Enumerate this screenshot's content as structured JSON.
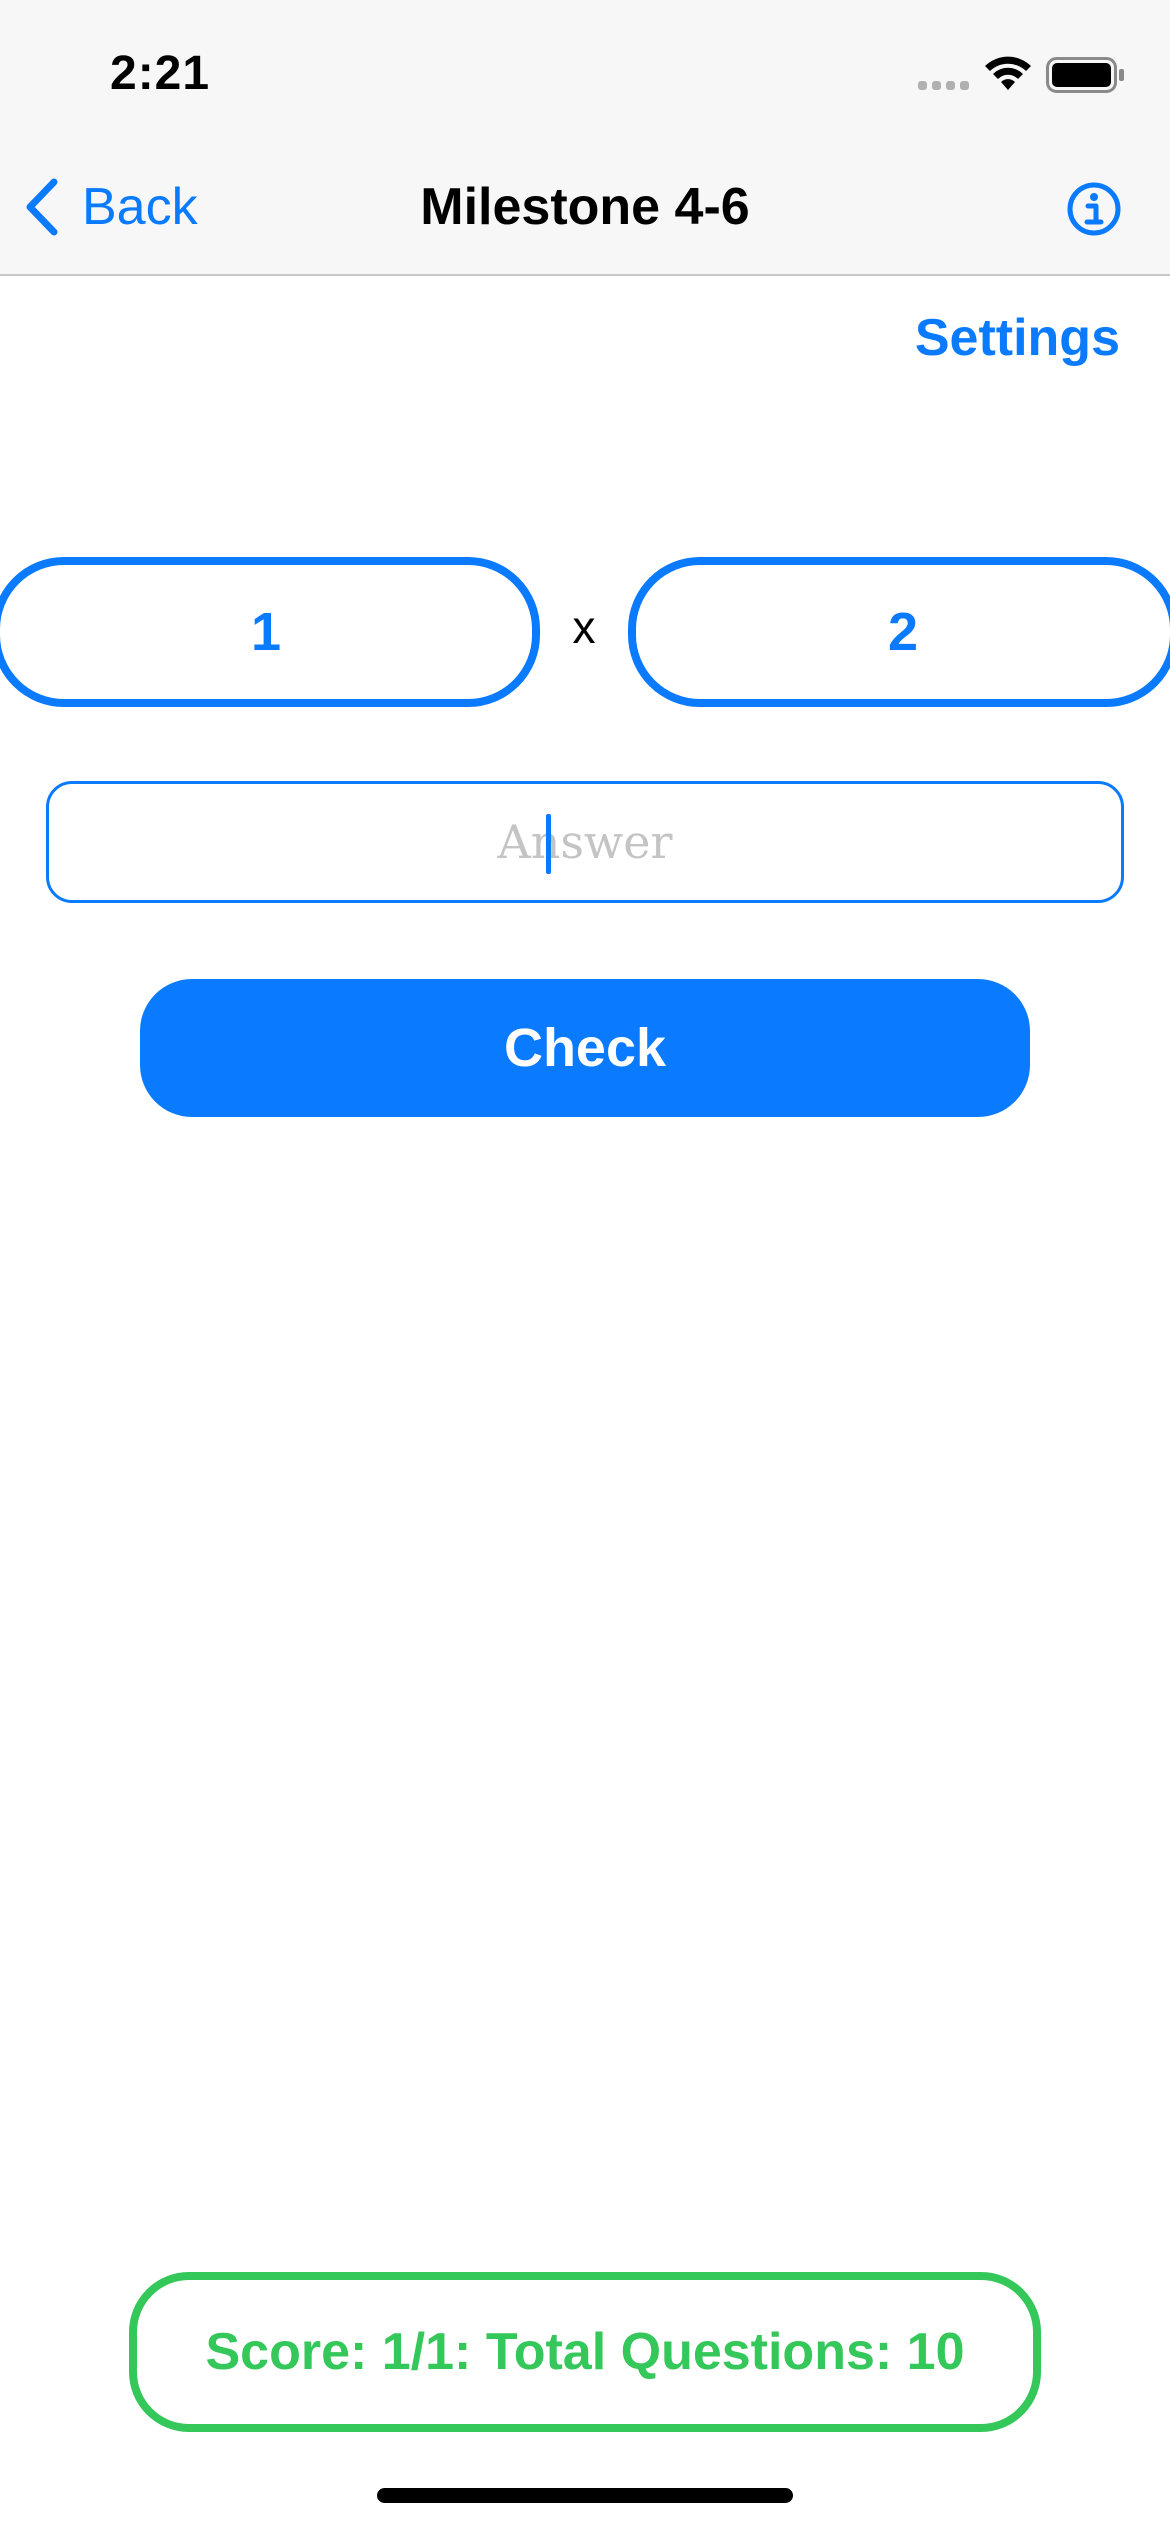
{
  "status_bar": {
    "time": "2:21"
  },
  "nav": {
    "back_label": "Back",
    "title": "Milestone 4-6",
    "info_icon": "info-circle-icon"
  },
  "settings_label": "Settings",
  "problem": {
    "operand_a": "1",
    "operator": "x",
    "operand_b": "2"
  },
  "answer": {
    "placeholder": "Answer",
    "value": ""
  },
  "check_label": "Check",
  "score_text": "Score: 1/1: Total Questions: 10",
  "colors": {
    "accent": "#0a7aff",
    "success": "#34c759",
    "nav_background": "#f7f7f7"
  }
}
